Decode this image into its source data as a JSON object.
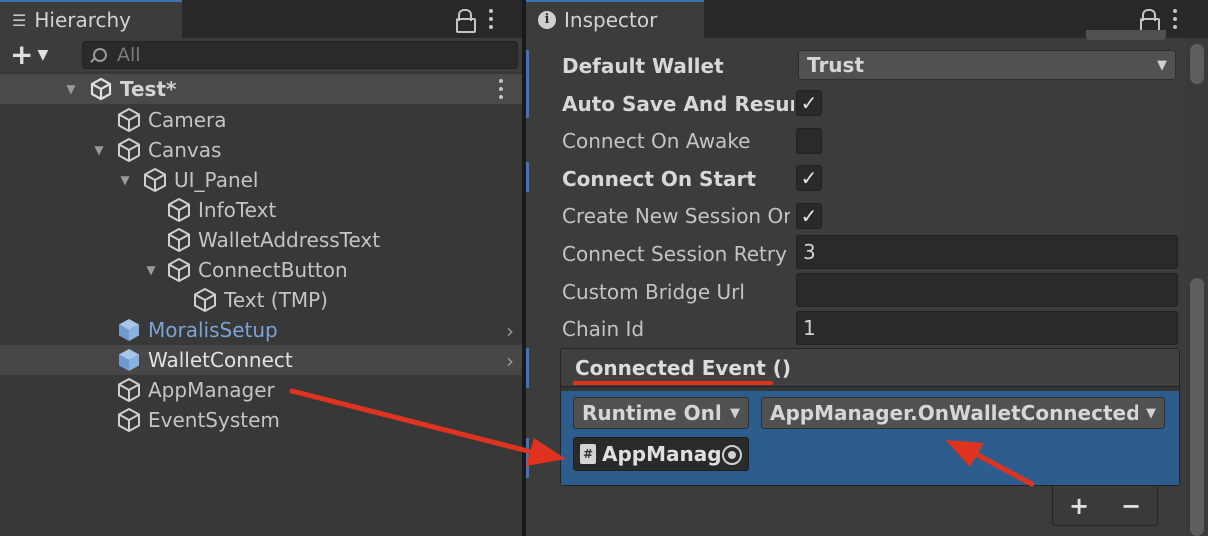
{
  "hierarchy": {
    "tab_title": "Hierarchy",
    "search_placeholder": "All",
    "items": [
      {
        "label": "Test*"
      },
      {
        "label": "Camera"
      },
      {
        "label": "Canvas"
      },
      {
        "label": "UI_Panel"
      },
      {
        "label": "InfoText"
      },
      {
        "label": "WalletAddressText"
      },
      {
        "label": "ConnectButton"
      },
      {
        "label": "Text (TMP)"
      },
      {
        "label": "MoralisSetup"
      },
      {
        "label": "WalletConnect"
      },
      {
        "label": "AppManager"
      },
      {
        "label": "EventSystem"
      }
    ]
  },
  "inspector": {
    "tab_title": "Inspector",
    "properties": [
      {
        "label": "Default Wallet",
        "value": "Trust"
      },
      {
        "label": "Auto Save And Resume",
        "checked": true
      },
      {
        "label": "Connect On Awake",
        "checked": false
      },
      {
        "label": "Connect On Start",
        "checked": true
      },
      {
        "label": "Create New Session On Sleep",
        "checked": true
      },
      {
        "label": "Connect Session Retry Count",
        "value": "3"
      },
      {
        "label": "Custom Bridge Url",
        "value": ""
      },
      {
        "label": "Chain Id",
        "value": "1"
      }
    ],
    "event": {
      "title": "Connected Event ()",
      "runtime_mode": "Runtime Only",
      "function": "AppManager.OnWalletConnected",
      "target_object": "AppManager",
      "add_label": "+",
      "remove_label": "−"
    }
  },
  "colors": {
    "annotation_red": "#e0331f",
    "selected_blue": "#2c5d8c",
    "prefab_blue": "#7ca3d6"
  },
  "icons": [
    "lock-icon",
    "kebab-icon",
    "plus-icon",
    "search-icon",
    "unity-scene-icon",
    "cube-icon",
    "prefab-cube-icon",
    "chevron-right-icon",
    "checkmark-icon",
    "script-icon",
    "object-picker-icon"
  ]
}
